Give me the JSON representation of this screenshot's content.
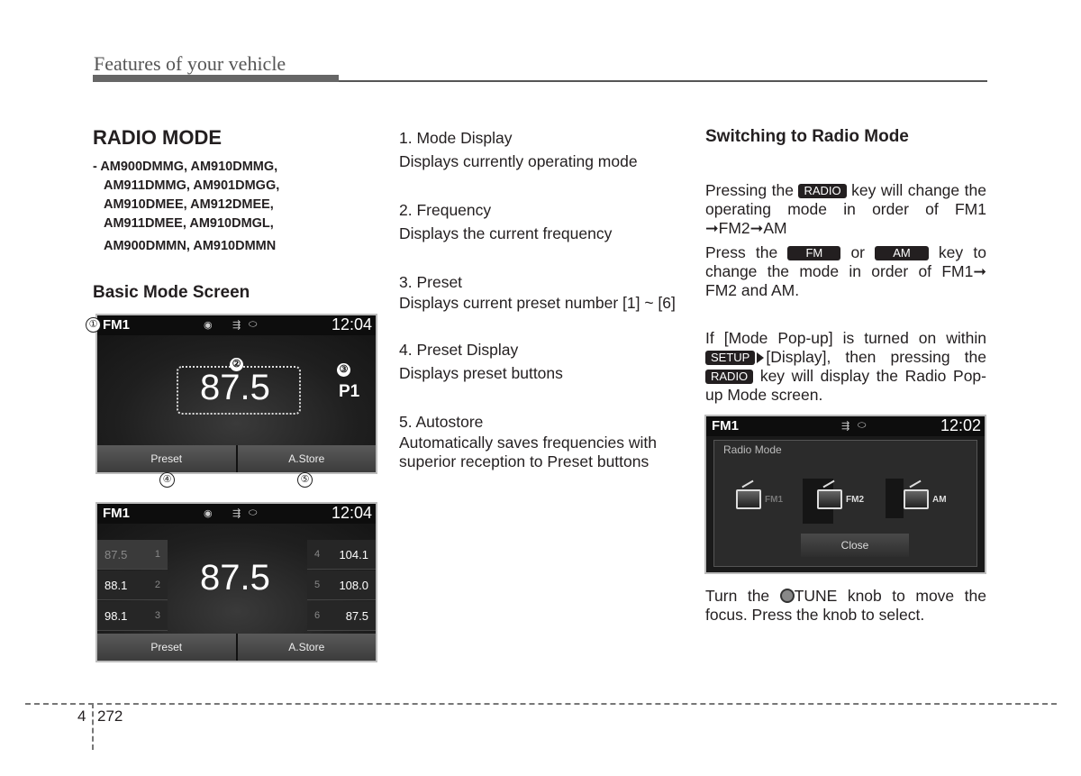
{
  "header": {
    "section_title": "Features of your vehicle"
  },
  "left": {
    "heading": "RADIO MODE",
    "models": [
      "- AM900DMMG, AM910DMMG,",
      "AM911DMMG, AM901DMGG,",
      "AM910DMEE, AM912DMEE,",
      "AM911DMEE, AM910DMGL,",
      "AM900DMMN, AM910DMMN"
    ],
    "subheading": "Basic Mode Screen",
    "screen1": {
      "mode": "FM1",
      "time": "12:04",
      "status_icons": [
        "disc-icon",
        "usb-icon",
        "ipod-icon"
      ],
      "frequency": "87.5",
      "preset": "P1",
      "buttons": [
        "Preset",
        "A.Store"
      ],
      "callouts": [
        "①",
        "②",
        "③",
        "④",
        "⑤"
      ]
    },
    "screen2": {
      "mode": "FM1",
      "time": "12:04",
      "frequency": "87.5",
      "presets_left": [
        {
          "freq": "87.5",
          "num": "1",
          "selected": true
        },
        {
          "freq": "88.1",
          "num": "2",
          "selected": false
        },
        {
          "freq": "98.1",
          "num": "3",
          "selected": false
        }
      ],
      "presets_right": [
        {
          "num": "4",
          "freq": "104.1"
        },
        {
          "num": "5",
          "freq": "108.0"
        },
        {
          "num": "6",
          "freq": "87.5"
        }
      ],
      "buttons": [
        "Preset",
        "A.Store"
      ]
    }
  },
  "middle": {
    "items": [
      {
        "title": "1. Mode Display",
        "desc": "Displays currently operating mode"
      },
      {
        "title": "2. Frequency",
        "desc": "Displays the current frequency"
      },
      {
        "title": "3. Preset",
        "desc": "Displays current preset number [1] ~ [6]"
      },
      {
        "title": "4. Preset Display",
        "desc": "Displays preset buttons"
      },
      {
        "title": "5. Autostore",
        "desc": "Automatically saves frequencies with superior reception to Preset buttons"
      }
    ]
  },
  "right": {
    "heading": "Switching to Radio Mode",
    "p1_a": "Pressing the",
    "key_radio": "RADIO",
    "p1_b": "key will change the operating mode in order of FM1 ➞FM2➞AM",
    "p2_a": "Press the",
    "key_fm": "FM",
    "p2_or": "or",
    "key_am": "AM",
    "p2_b": "key to change the mode in order of FM1➞ FM2 and AM.",
    "p3_a": "If [Mode Pop-up] is turned on within",
    "key_setup": "SETUP",
    "p3_b": "[Display], then pressing the",
    "p3_c": "key will display the Radio Pop-up Mode screen.",
    "popup": {
      "mode": "FM1",
      "time": "12:02",
      "title": "Radio Mode",
      "options": [
        "FM1",
        "FM2",
        "AM"
      ],
      "close": "Close"
    },
    "p4_a": "Turn the",
    "p4_b": "TUNE knob to move the focus. Press the knob to select."
  },
  "footer": {
    "chapter": "4",
    "page": "272"
  }
}
